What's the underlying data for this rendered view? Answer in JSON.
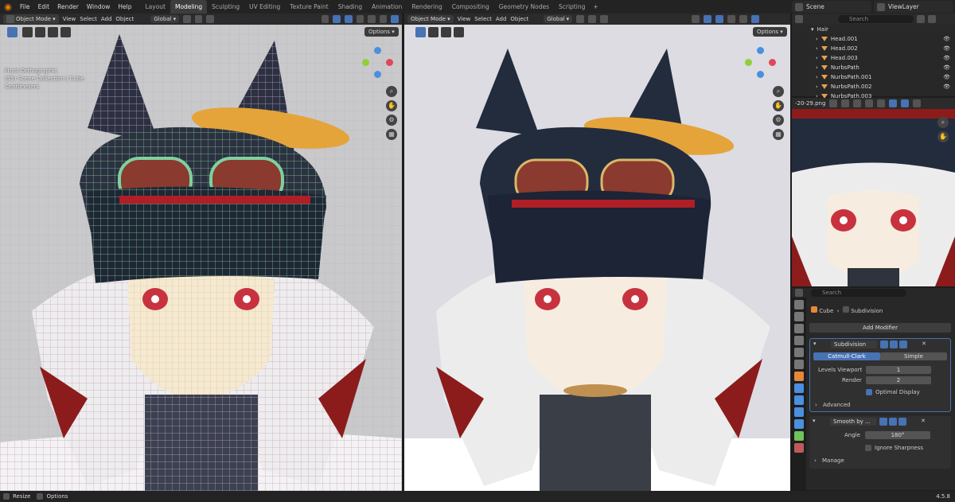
{
  "menu": [
    "File",
    "Edit",
    "Render",
    "Window",
    "Help"
  ],
  "workspaces": [
    "Layout",
    "Modeling",
    "Sculpting",
    "UV Editing",
    "Texture Paint",
    "Shading",
    "Animation",
    "Rendering",
    "Compositing",
    "Geometry Nodes",
    "Scripting",
    "+"
  ],
  "active_workspace": "Modeling",
  "scene": "Scene",
  "view_layer": "ViewLayer",
  "left_viewport": {
    "mode": "Object Mode",
    "menu": [
      "View",
      "Select",
      "Add",
      "Object"
    ],
    "transform": "Global",
    "options": "Options",
    "info": [
      "Front Orthographic",
      "(55) Scene Collection | Cube",
      "Centimeters"
    ]
  },
  "right_viewport": {
    "mode": "Object Mode",
    "menu": [
      "View",
      "Select",
      "Add",
      "Object"
    ],
    "transform": "Global",
    "options": "Options"
  },
  "image_editor": {
    "filename": "-20-29.png"
  },
  "outliner": {
    "search_placeholder": "Search",
    "collection": "Hair",
    "items": [
      "Head.001",
      "Head.002",
      "Head.003",
      "NurbsPath",
      "NurbsPath.001",
      "NurbsPath.002",
      "NurbsPath.003"
    ]
  },
  "properties": {
    "search_placeholder": "Search",
    "breadcrumb_object": "Cube",
    "breadcrumb_modifier": "Subdivision",
    "add_modifier": "Add Modifier",
    "subdivision": {
      "name": "Subdivision",
      "tab_catmull": "Catmull-Clark",
      "tab_simple": "Simple",
      "levels_viewport_label": "Levels Viewport",
      "levels_viewport": "1",
      "render_label": "Render",
      "render": "2",
      "optimal_display": "Optimal Display",
      "advanced": "Advanced"
    },
    "smooth": {
      "name": "Smooth by ...",
      "angle_label": "Angle",
      "angle": "180°",
      "ignore_sharpness": "Ignore Sharpness",
      "manage": "Manage"
    }
  },
  "status": {
    "resize": "Resize",
    "options": "Options",
    "version": "4.5.8"
  },
  "colors": {
    "accent": "#4772b3",
    "hat": "#232c3d",
    "eyes": "#c8323e",
    "glasses": "#8a3a2e",
    "gear": "#e5a43a",
    "hair": "#ececec",
    "hair_red": "#8c1c1c"
  }
}
